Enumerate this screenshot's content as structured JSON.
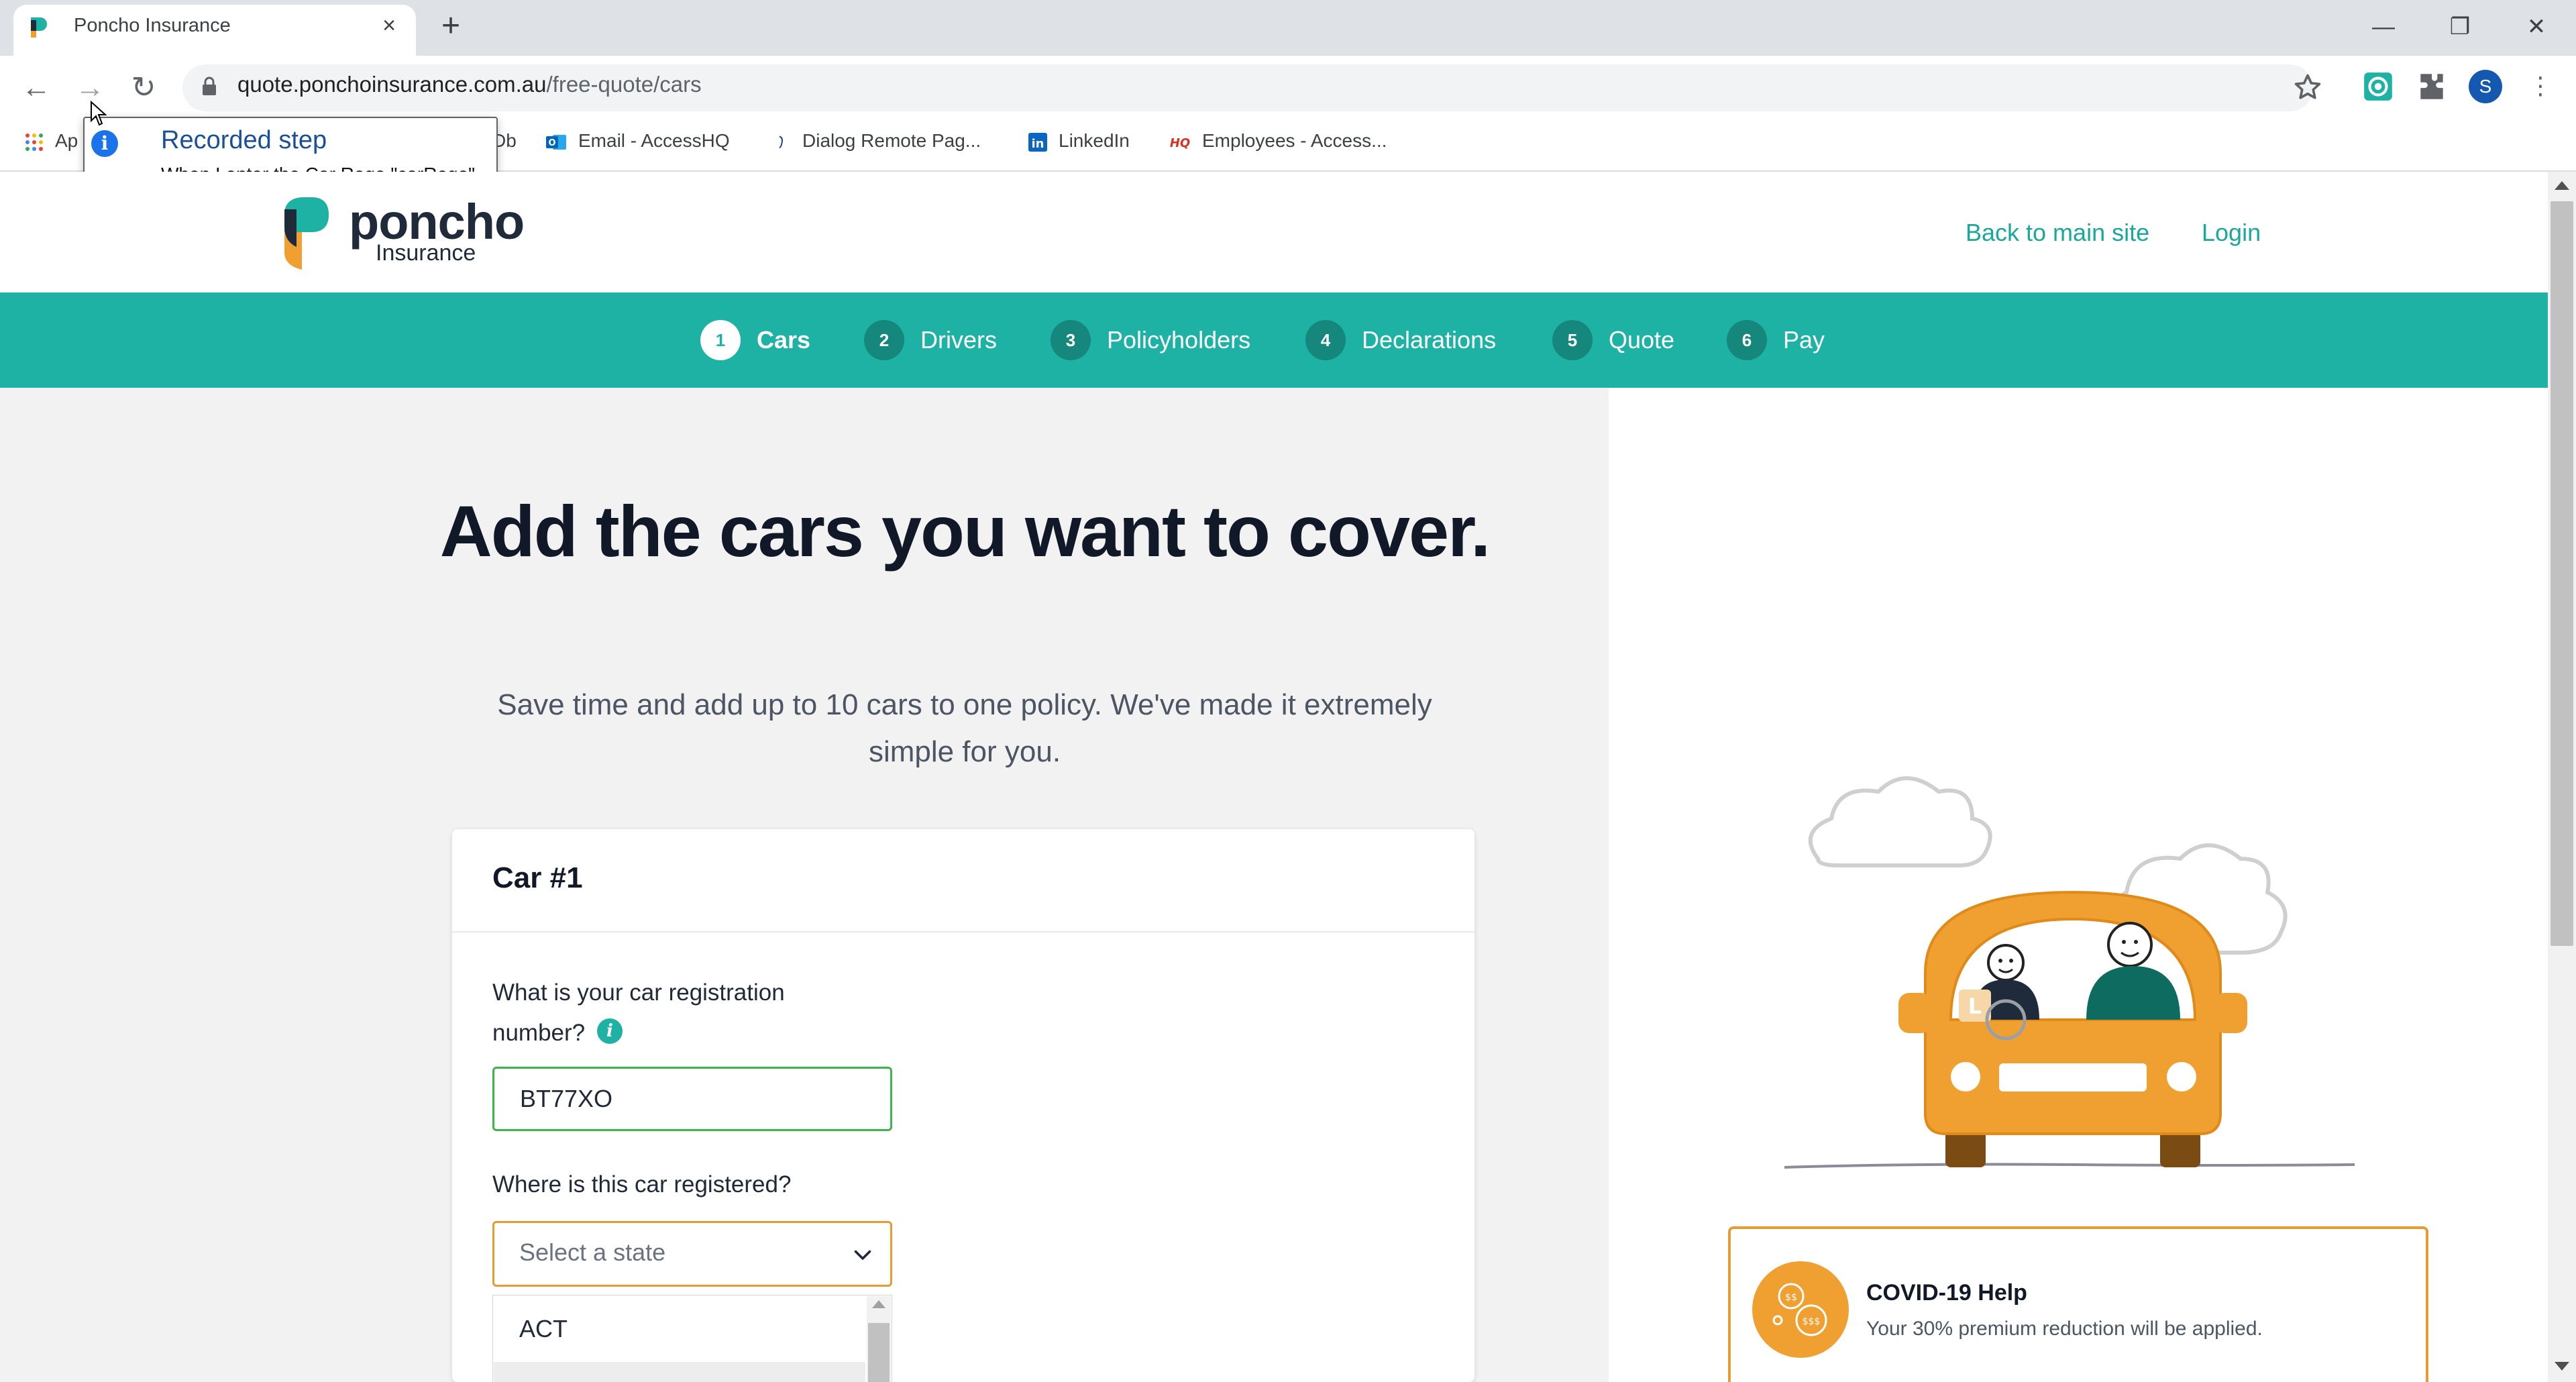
{
  "browser": {
    "tab_title": "Poncho Insurance",
    "tab_close": "×",
    "new_tab": "+",
    "window_controls": {
      "minimize": "—",
      "restore": "❐",
      "close": "✕"
    },
    "nav": {
      "back": "←",
      "forward": "→",
      "reload": "↻"
    },
    "url_host": "quote.ponchoinsurance.com.au",
    "url_path": "/free-quote/cars",
    "profile_initial": "S",
    "bookmarks": [
      {
        "label": "Ap",
        "icon": "apps-grid-icon"
      },
      {
        "label": "Db",
        "icon": ""
      },
      {
        "label": "Email - AccessHQ",
        "icon": "outlook-icon"
      },
      {
        "label": "Dialog Remote Pag...",
        "icon": "bracket-icon"
      },
      {
        "label": "LinkedIn",
        "icon": "linkedin-icon"
      },
      {
        "label": "Employees - Access...",
        "icon": "hq-icon"
      }
    ]
  },
  "tooltip": {
    "title": "Recorded step",
    "description": "When I enter the Car Rego \"carRego\""
  },
  "site": {
    "logo_word": "poncho",
    "logo_sub": "Insurance",
    "nav_links": {
      "back": "Back to main site",
      "login": "Login"
    },
    "steps": [
      {
        "num": "1",
        "label": "Cars",
        "active": true
      },
      {
        "num": "2",
        "label": "Drivers",
        "active": false
      },
      {
        "num": "3",
        "label": "Policyholders",
        "active": false
      },
      {
        "num": "4",
        "label": "Declarations",
        "active": false
      },
      {
        "num": "5",
        "label": "Quote",
        "active": false
      },
      {
        "num": "6",
        "label": "Pay",
        "active": false
      }
    ],
    "headline": "Add the cars you want to cover.",
    "subline": "Save time and add up to 10 cars to one policy. We've made it extremely simple for you."
  },
  "form": {
    "card_title": "Car #1",
    "rego_label": "What is your car registration number?",
    "rego_value": "BT77XO",
    "state_label": "Where is this car registered?",
    "state_placeholder": "Select a state",
    "state_options": [
      "ACT"
    ]
  },
  "covid": {
    "title": "COVID-19 Help",
    "text": "Your 30% premium reduction will be applied."
  },
  "colors": {
    "brand_teal": "#1db2a4",
    "brand_orange": "#e89b32",
    "valid_green": "#3cb54a"
  }
}
